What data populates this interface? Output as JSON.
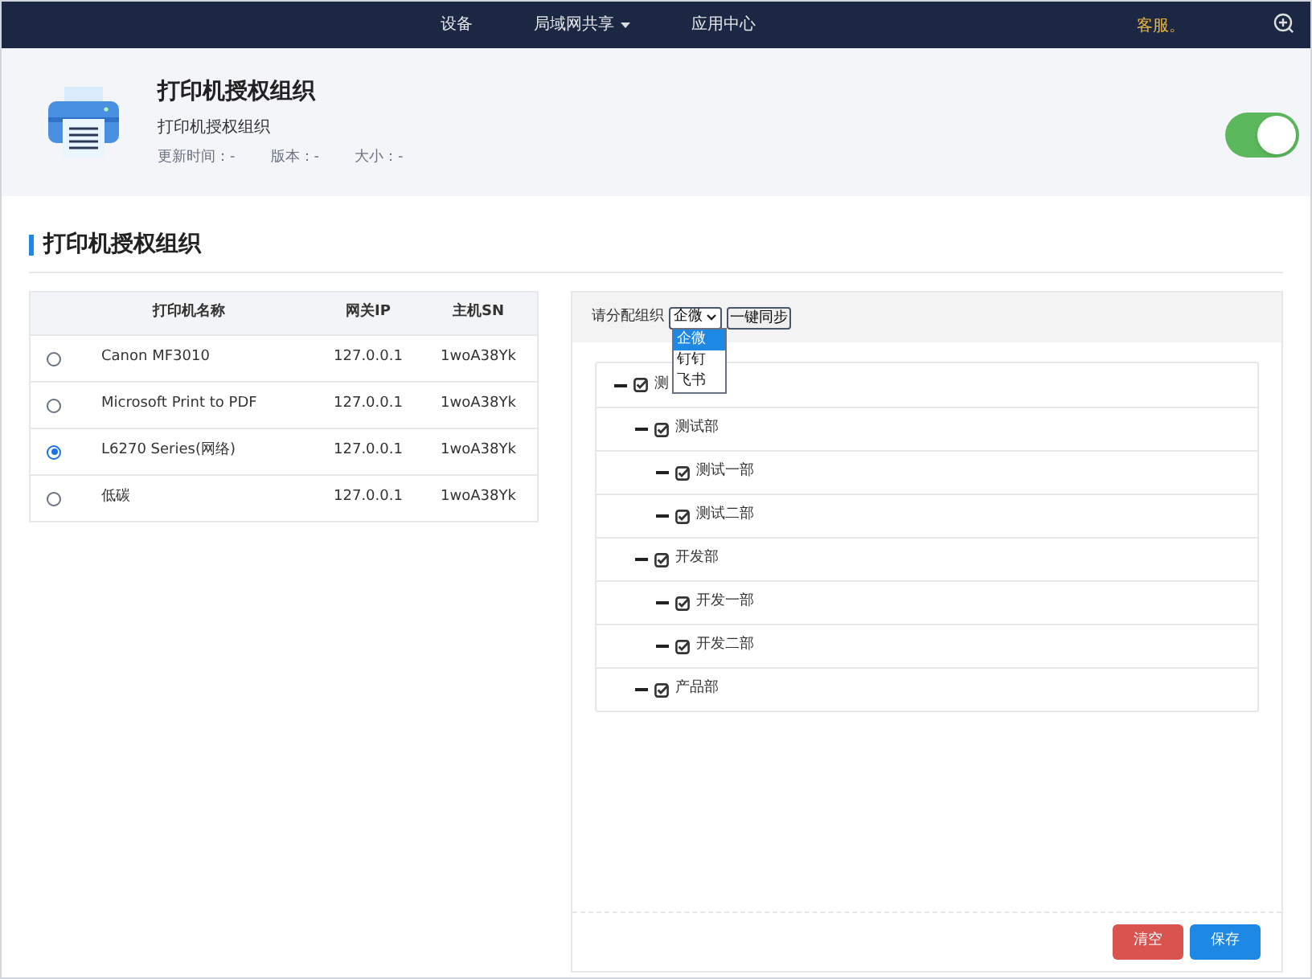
{
  "nav": {
    "items": [
      {
        "label": "设备",
        "dropdown": false
      },
      {
        "label": "局域网共享",
        "dropdown": true
      },
      {
        "label": "应用中心",
        "dropdown": false
      }
    ],
    "right_text": "客服。"
  },
  "app": {
    "title": "打印机授权组织",
    "subtitle": "打印机授权组织",
    "meta": [
      "更新时间：-",
      "版本：-",
      "大小：-"
    ],
    "enabled": true
  },
  "section_title": "打印机授权组织",
  "table": {
    "columns": [
      "打印机名称",
      "网关IP",
      "主机SN"
    ],
    "rows": [
      {
        "name": "Canon MF3010",
        "ip": "127.0.0.1",
        "sn": "1woA38Yk",
        "selected": false
      },
      {
        "name": "Microsoft Print to PDF",
        "ip": "127.0.0.1",
        "sn": "1woA38Yk",
        "selected": false
      },
      {
        "name": "L6270 Series(网络)",
        "ip": "127.0.0.1",
        "sn": "1woA38Yk",
        "selected": true
      },
      {
        "name": "低碳",
        "ip": "127.0.0.1",
        "sn": "1woA38Yk",
        "selected": false
      }
    ]
  },
  "org": {
    "label": "请分配组织",
    "select_value": "企微",
    "sync_button": "一键同步",
    "options": [
      {
        "label": "企微",
        "selected": true
      },
      {
        "label": "钉钉",
        "selected": false
      },
      {
        "label": "飞书",
        "selected": false
      }
    ],
    "tree": [
      {
        "label": "测",
        "checked": true,
        "expanded": true,
        "children": [
          {
            "label": "测试部",
            "checked": true,
            "expanded": true,
            "children": [
              {
                "label": "测试一部",
                "checked": true,
                "expanded": true
              },
              {
                "label": "测试二部",
                "checked": true,
                "expanded": true
              }
            ]
          },
          {
            "label": "开发部",
            "checked": true,
            "expanded": true,
            "children": [
              {
                "label": "开发一部",
                "checked": true,
                "expanded": true
              },
              {
                "label": "开发二部",
                "checked": true,
                "expanded": true
              }
            ]
          },
          {
            "label": "产品部",
            "checked": true,
            "expanded": true
          }
        ]
      }
    ]
  },
  "buttons": [
    {
      "label": "清空",
      "kind": "danger"
    },
    {
      "label": "保存",
      "kind": "primary"
    }
  ]
}
